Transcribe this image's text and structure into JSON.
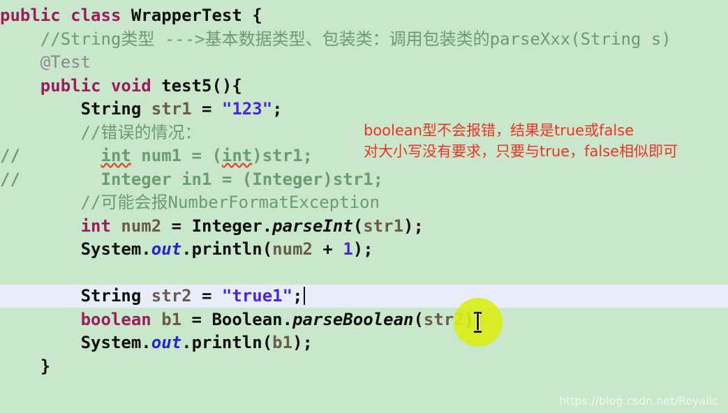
{
  "editor": {
    "background_color": "#c9e7cb",
    "current_line_highlight_color": "#e7eef9",
    "top_partial_line": "    //...",
    "lines": [
      {
        "id": "class-decl",
        "tokens": [
          {
            "text": "public",
            "kind": "kw"
          },
          {
            "text": " ",
            "kind": "plain"
          },
          {
            "text": "class",
            "kind": "kw"
          },
          {
            "text": " ",
            "kind": "plain"
          },
          {
            "text": "WrapperTest",
            "kind": "cls"
          },
          {
            "text": " {",
            "kind": "plain"
          }
        ]
      },
      {
        "id": "comment-string-type",
        "tokens": [
          {
            "text": "    //String类型 --->基本数据类型、包装类：调用包装类的parseXxx(String s)",
            "kind": "comment"
          }
        ]
      },
      {
        "id": "annotation-test",
        "tokens": [
          {
            "text": "    @Test",
            "kind": "annot"
          }
        ]
      },
      {
        "id": "method-test5",
        "tokens": [
          {
            "text": "    ",
            "kind": "plain"
          },
          {
            "text": "public",
            "kind": "kw"
          },
          {
            "text": " ",
            "kind": "plain"
          },
          {
            "text": "void",
            "kind": "kw"
          },
          {
            "text": " ",
            "kind": "plain"
          },
          {
            "text": "test5",
            "kind": "plain"
          },
          {
            "text": "(){",
            "kind": "plain"
          }
        ]
      },
      {
        "id": "decl-str1",
        "tokens": [
          {
            "text": "        ",
            "kind": "plain"
          },
          {
            "text": "String",
            "kind": "cls"
          },
          {
            "text": " ",
            "kind": "plain"
          },
          {
            "text": "str1",
            "kind": "ident"
          },
          {
            "text": " = ",
            "kind": "op"
          },
          {
            "text": "\"123\"",
            "kind": "str"
          },
          {
            "text": ";",
            "kind": "plain"
          }
        ]
      },
      {
        "id": "comment-error-case",
        "tokens": [
          {
            "text": "        //错误的情况：",
            "kind": "comment"
          }
        ]
      },
      {
        "id": "commented-int-num1",
        "tokens": [
          {
            "text": "//",
            "kind": "cmtcode"
          },
          {
            "text": "        ",
            "kind": "cmtcode"
          },
          {
            "text": "int",
            "kind": "cmtcode-err"
          },
          {
            "text": " num1 = (",
            "kind": "cmtcode"
          },
          {
            "text": "int",
            "kind": "cmtcode-err"
          },
          {
            "text": ")str1;",
            "kind": "cmtcode"
          }
        ]
      },
      {
        "id": "commented-integer-in1",
        "tokens": [
          {
            "text": "//",
            "kind": "cmtcode"
          },
          {
            "text": "        ",
            "kind": "cmtcode"
          },
          {
            "text": "Integer in1 = (Integer)str1;",
            "kind": "cmtcode"
          }
        ]
      },
      {
        "id": "comment-nfe",
        "tokens": [
          {
            "text": "        //可能会报NumberFormatException",
            "kind": "comment"
          }
        ]
      },
      {
        "id": "parse-int-line",
        "tokens": [
          {
            "text": "        ",
            "kind": "plain"
          },
          {
            "text": "int",
            "kind": "kw"
          },
          {
            "text": " ",
            "kind": "plain"
          },
          {
            "text": "num2",
            "kind": "ident"
          },
          {
            "text": " = ",
            "kind": "op"
          },
          {
            "text": "Integer",
            "kind": "cls"
          },
          {
            "text": ".",
            "kind": "plain"
          },
          {
            "text": "parseInt",
            "kind": "methital"
          },
          {
            "text": "(",
            "kind": "plain"
          },
          {
            "text": "str1",
            "kind": "ident"
          },
          {
            "text": ");",
            "kind": "plain"
          }
        ]
      },
      {
        "id": "println-num2",
        "tokens": [
          {
            "text": "        ",
            "kind": "plain"
          },
          {
            "text": "System",
            "kind": "cls"
          },
          {
            "text": ".",
            "kind": "plain"
          },
          {
            "text": "out",
            "kind": "fieldital"
          },
          {
            "text": ".",
            "kind": "plain"
          },
          {
            "text": "println",
            "kind": "plain"
          },
          {
            "text": "(",
            "kind": "plain"
          },
          {
            "text": "num2",
            "kind": "ident"
          },
          {
            "text": " + ",
            "kind": "op"
          },
          {
            "text": "1",
            "kind": "num"
          },
          {
            "text": ");",
            "kind": "plain"
          }
        ]
      },
      {
        "id": "blank-line",
        "tokens": [
          {
            "text": " ",
            "kind": "plain"
          }
        ]
      },
      {
        "id": "decl-str2",
        "current": true,
        "tokens": [
          {
            "text": "        ",
            "kind": "plain"
          },
          {
            "text": "String",
            "kind": "cls"
          },
          {
            "text": " ",
            "kind": "plain"
          },
          {
            "text": "str2",
            "kind": "ident"
          },
          {
            "text": " = ",
            "kind": "op"
          },
          {
            "text": "\"true1\"",
            "kind": "str"
          },
          {
            "text": ";",
            "kind": "plain"
          }
        ]
      },
      {
        "id": "parse-boolean-line",
        "tokens": [
          {
            "text": "        ",
            "kind": "plain"
          },
          {
            "text": "boolean",
            "kind": "kw"
          },
          {
            "text": " ",
            "kind": "plain"
          },
          {
            "text": "b1",
            "kind": "ident"
          },
          {
            "text": " = ",
            "kind": "op"
          },
          {
            "text": "Boolean",
            "kind": "cls"
          },
          {
            "text": ".",
            "kind": "plain"
          },
          {
            "text": "parseBoolean",
            "kind": "methital"
          },
          {
            "text": "(",
            "kind": "plain"
          },
          {
            "text": "str2",
            "kind": "ident"
          },
          {
            "text": ");",
            "kind": "plain"
          }
        ]
      },
      {
        "id": "println-b1",
        "tokens": [
          {
            "text": "        ",
            "kind": "plain"
          },
          {
            "text": "System",
            "kind": "cls"
          },
          {
            "text": ".",
            "kind": "plain"
          },
          {
            "text": "out",
            "kind": "fieldital"
          },
          {
            "text": ".",
            "kind": "plain"
          },
          {
            "text": "println",
            "kind": "plain"
          },
          {
            "text": "(",
            "kind": "plain"
          },
          {
            "text": "b1",
            "kind": "ident"
          },
          {
            "text": ");",
            "kind": "plain"
          }
        ]
      },
      {
        "id": "close-brace",
        "tokens": [
          {
            "text": "    }",
            "kind": "plain"
          }
        ]
      }
    ]
  },
  "annotation": {
    "color": "#ee3322",
    "line1": "boolean型不会报错，结果是true或false",
    "line2": "对大小写没有要求，只要与true，false相似即可"
  },
  "cursor": {
    "halo_color": "#d9ee18",
    "icon": "i-beam-text-cursor"
  },
  "watermark": {
    "text": "https://blog.csdn.net/Royalic"
  }
}
